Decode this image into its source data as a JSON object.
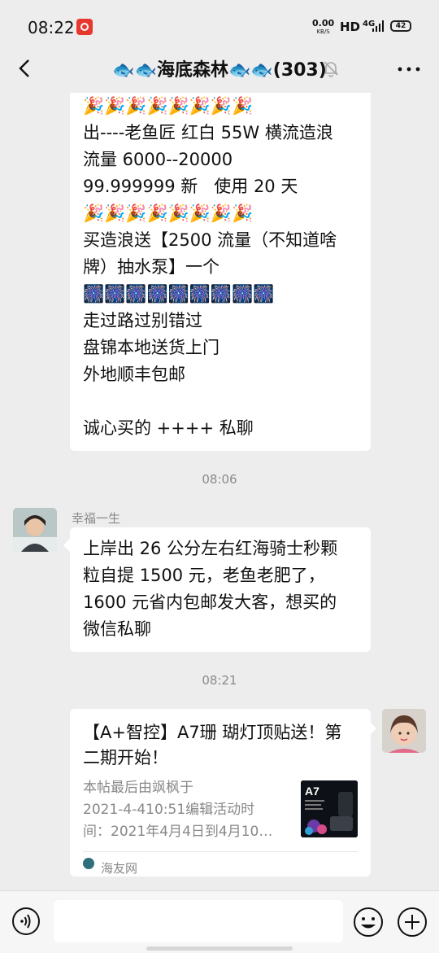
{
  "status": {
    "time": "08:22",
    "speed_value": "0.00",
    "speed_unit": "KB/S",
    "hd": "HD",
    "network": "4G",
    "battery": "42"
  },
  "header": {
    "title": "🐟🐟海底森林🐟🐟(303)",
    "back_icon": "chevron-left-icon",
    "mute_icon": "bell-muted-icon",
    "more_icon": "ellipsis-icon"
  },
  "messages": [
    {
      "lines": [
        "🎉🎉🎉🎉🎉🎉🎉🎉",
        "出----老鱼匠 红白 55W 横流造浪",
        "流量 6000--20000",
        "99.999999 新   使用 20 天",
        "🎉🎉🎉🎉🎉🎉🎉🎉",
        "买造浪送【2500 流量（不知道啥",
        "牌）抽水泵】一个",
        "🎆🎆🎆🎆🎆🎆🎆🎆🎆",
        "走过路过别错过",
        "盘锦本地送货上门",
        "外地顺丰包邮",
        "",
        "诚心买的 ++++ 私聊"
      ]
    },
    {
      "timestamp": "08:06",
      "sender": "幸福一生",
      "lines": [
        "上岸出 26 公分左右红海骑士秒颗",
        "粒自提 1500 元，老鱼老肥了，",
        "1600 元省内包邮发大客，想买的",
        "微信私聊"
      ]
    },
    {
      "timestamp": "08:21",
      "card": {
        "title_lines": [
          "【A+智控】A7珊 瑚灯顶贴送！第",
          "二期开始！"
        ],
        "desc_lines": [
          "本帖最后由飒枫于",
          "2021-4-410:51编辑活动时",
          "间：2021年4月4日到4月10…"
        ],
        "thumb_label": "A7",
        "source": "海友网"
      }
    }
  ],
  "input": {
    "voice_icon": "voice-icon",
    "emoji_icon": "emoji-icon",
    "plus_icon": "plus-icon"
  }
}
